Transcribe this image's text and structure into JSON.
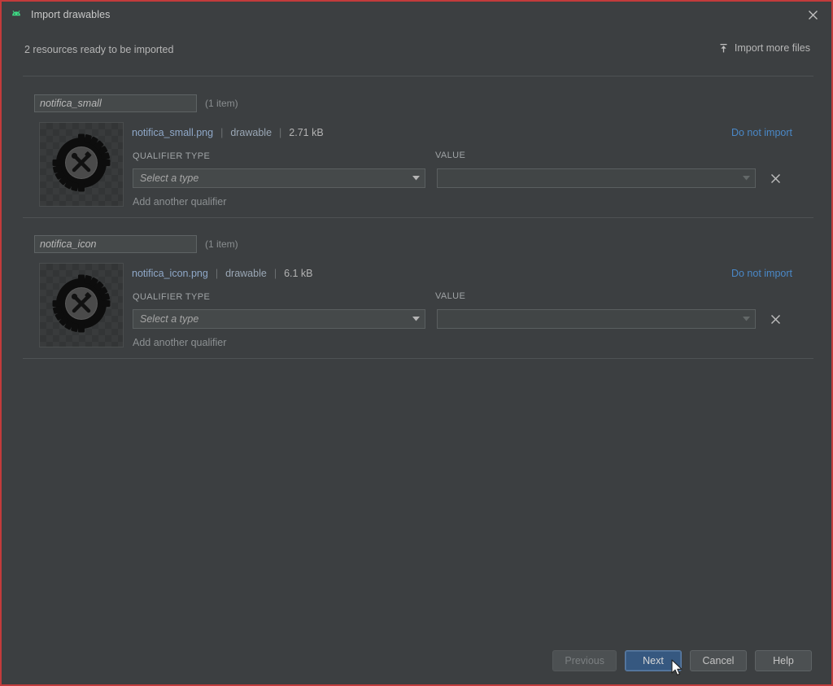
{
  "window": {
    "title": "Import drawables",
    "app_icon": "android-robot-icon",
    "close_icon": "close-icon",
    "border_color": "#c23b3b",
    "background": "#3c3f41"
  },
  "header": {
    "status_text": "2 resources ready to be imported",
    "import_more_label": "Import more files",
    "import_more_icon": "import-upload-icon"
  },
  "colors": {
    "link_blue": "#4a88c7",
    "filename_blue": "#8fa8c8",
    "primary_button": "#365880",
    "panel": "#3c3f41",
    "field": "#45494a"
  },
  "labels": {
    "qualifier_type": "QUALIFIER TYPE",
    "value": "VALUE",
    "add_another_qualifier": "Add another qualifier",
    "do_not_import": "Do not import",
    "select_a_type_placeholder": "Select a type",
    "value_placeholder": "",
    "remove_icon": "close-x-icon",
    "dropdown_icon": "chevron-down-icon"
  },
  "groups": [
    {
      "name": "notifica_small",
      "count_label": "(1 item)",
      "resource": {
        "filename": "notifica_small.png",
        "divider": "|",
        "type": "drawable",
        "size": "2.71 kB",
        "thumbnail_icon": "gear-hammer-wrench-icon",
        "qualifier_value": "",
        "value_value": ""
      }
    },
    {
      "name": "notifica_icon",
      "count_label": "(1 item)",
      "resource": {
        "filename": "notifica_icon.png",
        "divider": "|",
        "type": "drawable",
        "size": "6.1 kB",
        "thumbnail_icon": "gear-hammer-wrench-icon",
        "qualifier_value": "",
        "value_value": ""
      }
    }
  ],
  "footer": {
    "buttons": [
      {
        "label": "Previous",
        "state": "disabled"
      },
      {
        "label": "Next",
        "state": "primary"
      },
      {
        "label": "Cancel",
        "state": "normal"
      },
      {
        "label": "Help",
        "state": "normal"
      }
    ]
  }
}
